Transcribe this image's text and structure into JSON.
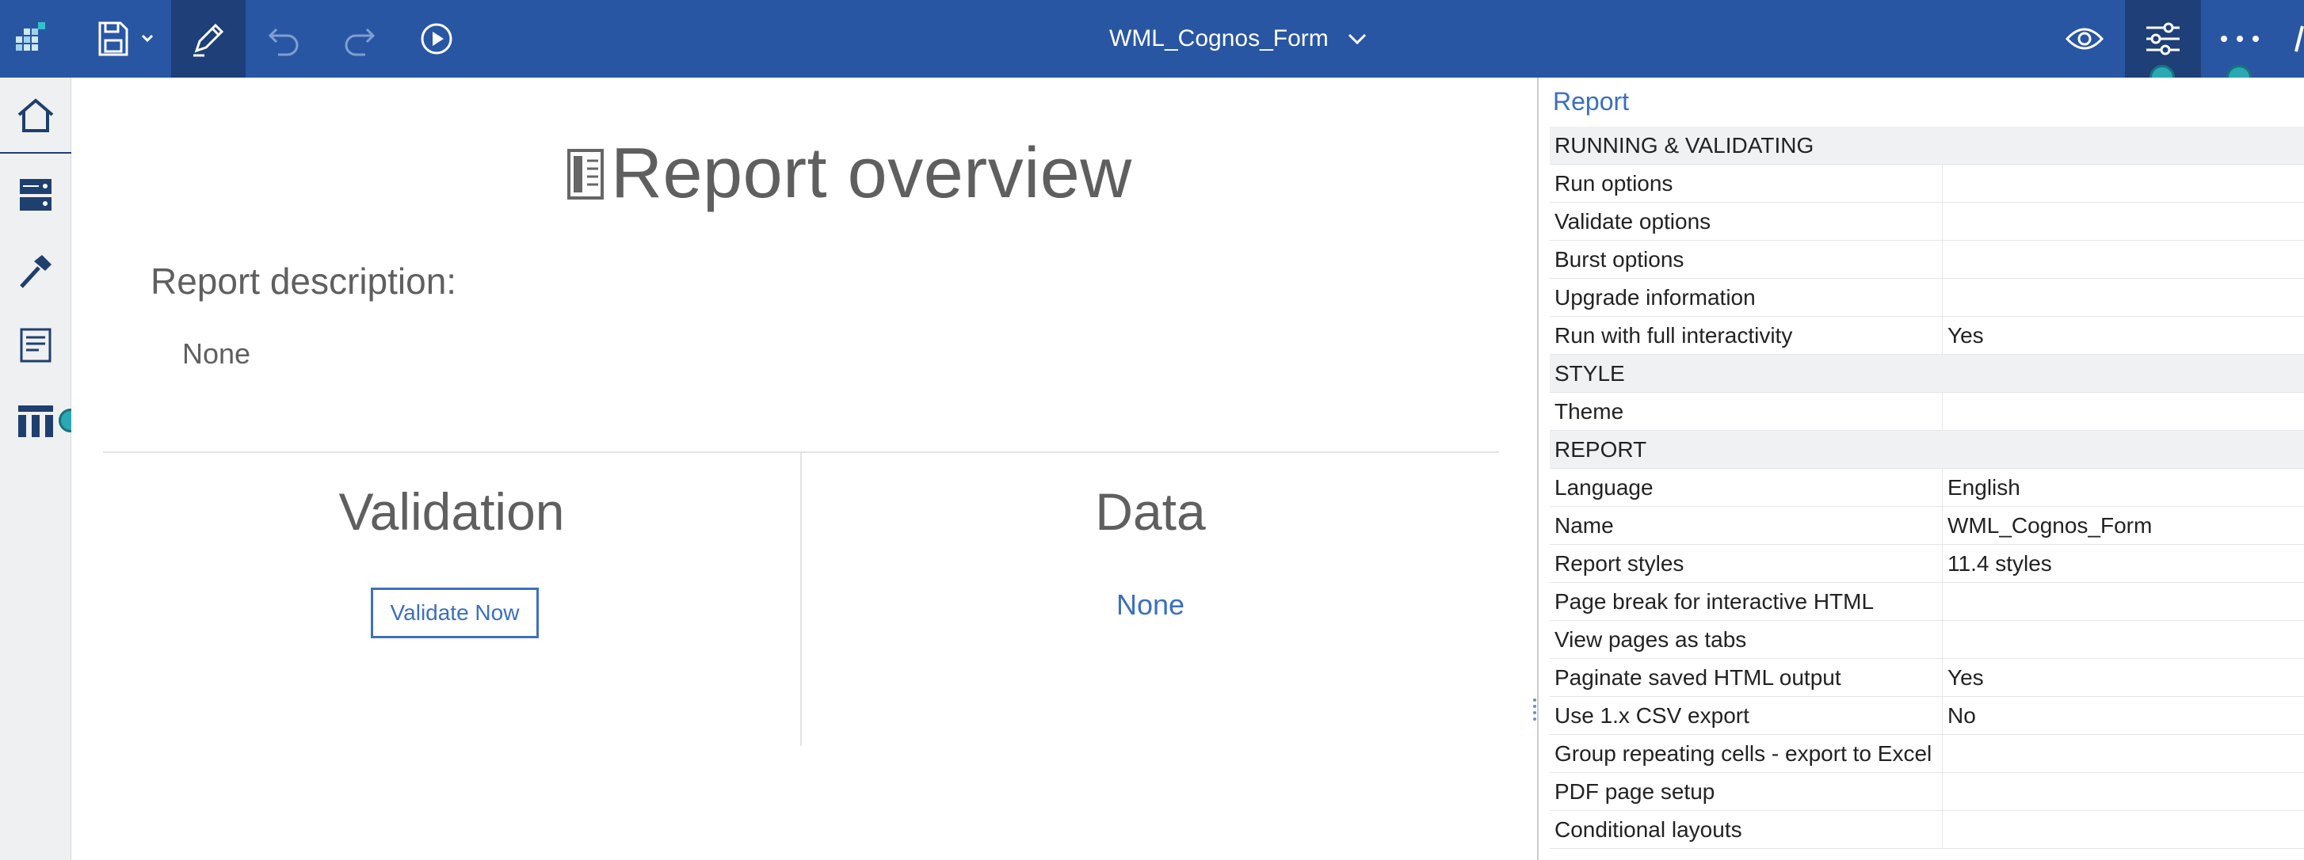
{
  "colors": {
    "topbar": "#2956a3",
    "topbar_active": "#1e3f78",
    "accent_link": "#3b6fbe",
    "teal_indicator": "#2aa8b4",
    "rail_bg": "#eff0f2"
  },
  "topbar": {
    "app_icon": "app-grid-icon",
    "save_icon": "save-icon",
    "edit_icon": "pencil-icon",
    "undo_icon": "undo-icon",
    "redo_icon": "redo-icon",
    "run_icon": "play-icon",
    "report_title": "WML_Cognos_Form",
    "preview_icon": "eye-icon",
    "properties_icon": "sliders-icon",
    "more_icon": "ellipsis-icon"
  },
  "leftrail": {
    "items": [
      {
        "icon": "home-icon"
      },
      {
        "icon": "data-server-icon"
      },
      {
        "icon": "toolbox-hammer-icon"
      },
      {
        "icon": "page-icon"
      },
      {
        "icon": "table-columns-icon"
      }
    ]
  },
  "overview": {
    "title": "Report overview",
    "description_label": "Report description:",
    "description_value": "None",
    "validation_heading": "Validation",
    "validate_button": "Validate Now",
    "data_heading": "Data",
    "data_value": "None"
  },
  "properties": {
    "header": "Report",
    "rows": [
      {
        "type": "section",
        "name": "RUNNING & VALIDATING",
        "value": ""
      },
      {
        "type": "row",
        "name": "Run options",
        "value": ""
      },
      {
        "type": "row",
        "name": "Validate options",
        "value": ""
      },
      {
        "type": "row",
        "name": "Burst options",
        "value": ""
      },
      {
        "type": "row",
        "name": "Upgrade information",
        "value": ""
      },
      {
        "type": "row",
        "name": "Run with full interactivity",
        "value": "Yes"
      },
      {
        "type": "section",
        "name": "STYLE",
        "value": ""
      },
      {
        "type": "row",
        "name": "Theme",
        "value": ""
      },
      {
        "type": "section",
        "name": "REPORT",
        "value": ""
      },
      {
        "type": "row",
        "name": "Language",
        "value": "English"
      },
      {
        "type": "row",
        "name": "Name",
        "value": "WML_Cognos_Form"
      },
      {
        "type": "row",
        "name": "Report styles",
        "value": "11.4 styles"
      },
      {
        "type": "row",
        "name": "Page break for interactive HTML",
        "value": ""
      },
      {
        "type": "row",
        "name": "View pages as tabs",
        "value": ""
      },
      {
        "type": "row",
        "name": "Paginate saved HTML output",
        "value": "Yes"
      },
      {
        "type": "row",
        "name": "Use 1.x CSV export",
        "value": "No"
      },
      {
        "type": "row",
        "name": "Group repeating cells - export to Excel",
        "value": ""
      },
      {
        "type": "row",
        "name": "PDF page setup",
        "value": ""
      },
      {
        "type": "row",
        "name": "Conditional layouts",
        "value": ""
      }
    ]
  }
}
